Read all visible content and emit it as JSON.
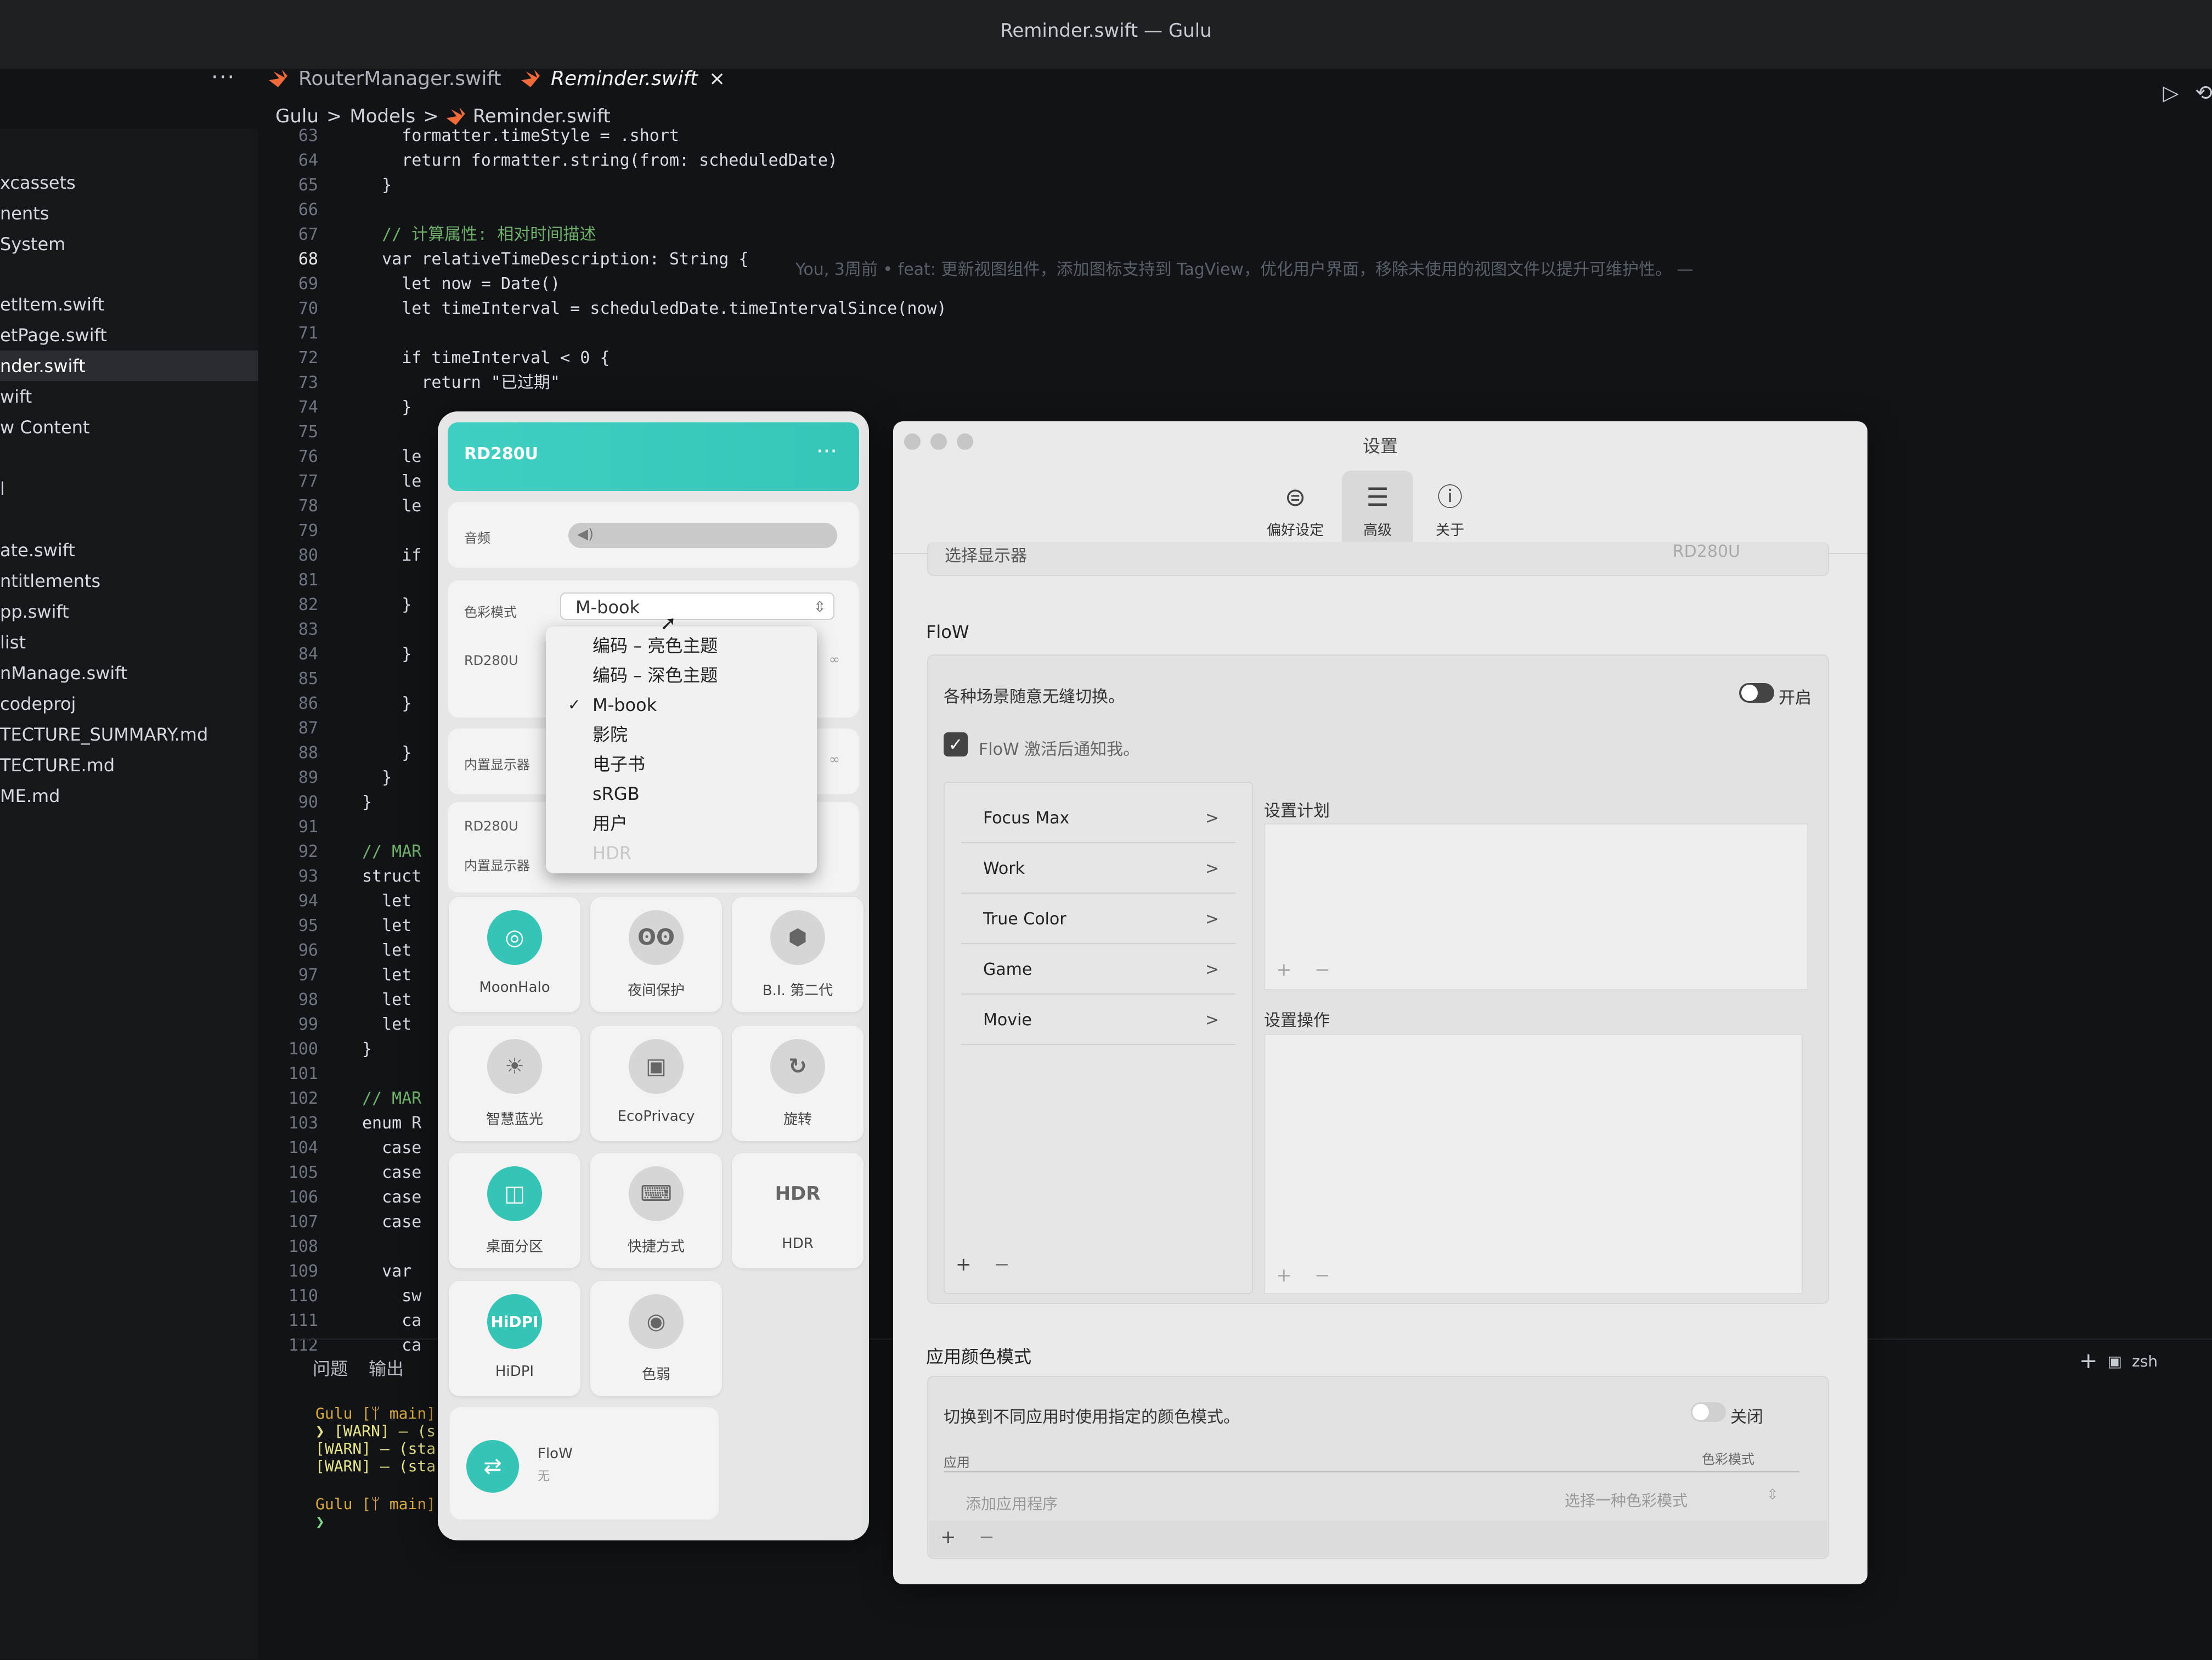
{
  "window_title": "Reminder.swift — Gulu",
  "tabs": [
    {
      "label": "RouterManager.swift"
    },
    {
      "label": "Reminder.swift"
    }
  ],
  "tab_close": "×",
  "more": "···",
  "breadcrumb": {
    "p1": "Gulu",
    "p2": "Models",
    "p3": "Reminder.swift",
    "sep": ">"
  },
  "sidebar_items": [
    "xcassets",
    "nents",
    "System",
    "etItem.swift",
    "etPage.swift",
    "nder.swift",
    "wift",
    "w Content",
    "l",
    "ate.swift",
    "ntitlements",
    "pp.swift",
    "list",
    "nManage.swift",
    "codeproj",
    "TECTURE_SUMMARY.md",
    "TECTURE.md",
    "ME.md"
  ],
  "code_lines": [
    {
      "n": "63",
      "t": "    formatter.timeStyle = .short"
    },
    {
      "n": "64",
      "t": "    return formatter.string(from: scheduledDate)"
    },
    {
      "n": "65",
      "t": "  }"
    },
    {
      "n": "66",
      "t": ""
    },
    {
      "n": "67",
      "t": "  // 计算属性: 相对时间描述"
    },
    {
      "n": "68",
      "t": "  var relativeTimeDescription: String {"
    },
    {
      "n": "69",
      "t": "    let now = Date()"
    },
    {
      "n": "70",
      "t": "    let timeInterval = scheduledDate.timeIntervalSince(now)"
    },
    {
      "n": "71",
      "t": ""
    },
    {
      "n": "72",
      "t": "    if timeInterval < 0 {"
    },
    {
      "n": "73",
      "t": "      return \"已过期\""
    },
    {
      "n": "74",
      "t": "    }"
    },
    {
      "n": "75",
      "t": ""
    },
    {
      "n": "76",
      "t": "    le"
    },
    {
      "n": "77",
      "t": "    le"
    },
    {
      "n": "78",
      "t": "    le"
    },
    {
      "n": "79",
      "t": ""
    },
    {
      "n": "80",
      "t": "    if"
    },
    {
      "n": "81",
      "t": ""
    },
    {
      "n": "82",
      "t": "    }"
    },
    {
      "n": "83",
      "t": ""
    },
    {
      "n": "84",
      "t": "    }"
    },
    {
      "n": "85",
      "t": ""
    },
    {
      "n": "86",
      "t": "    }"
    },
    {
      "n": "87",
      "t": ""
    },
    {
      "n": "88",
      "t": "    }"
    },
    {
      "n": "89",
      "t": "  }"
    },
    {
      "n": "90",
      "t": "}"
    },
    {
      "n": "91",
      "t": ""
    },
    {
      "n": "92",
      "t": "// MAR"
    },
    {
      "n": "93",
      "t": "struct"
    },
    {
      "n": "94",
      "t": "  let"
    },
    {
      "n": "95",
      "t": "  let"
    },
    {
      "n": "96",
      "t": "  let"
    },
    {
      "n": "97",
      "t": "  let"
    },
    {
      "n": "98",
      "t": "  let"
    },
    {
      "n": "99",
      "t": "  let"
    },
    {
      "n": "100",
      "t": "}"
    },
    {
      "n": "101",
      "t": ""
    },
    {
      "n": "102",
      "t": "// MAR"
    },
    {
      "n": "103",
      "t": "enum R"
    },
    {
      "n": "104",
      "t": "  case"
    },
    {
      "n": "105",
      "t": "  case"
    },
    {
      "n": "106",
      "t": "  case"
    },
    {
      "n": "107",
      "t": "  case"
    },
    {
      "n": "108",
      "t": ""
    },
    {
      "n": "109",
      "t": "  var"
    },
    {
      "n": "110",
      "t": "    sw"
    },
    {
      "n": "111",
      "t": "    ca"
    },
    {
      "n": "112",
      "t": "    ca"
    }
  ],
  "blame": "You, 3周前 • feat: 更新视图组件，添加图标支持到 TagView，优化用户界面，移除未使用的视图文件以提升可维护性。 —",
  "terminal": {
    "tabs": [
      "问题",
      "输出"
    ],
    "lines": [
      "Gulu [ᛘ main]",
      "❯ [WARN] – (s",
      "[WARN] – (sta",
      "[WARN] – (sta",
      "",
      "Gulu [ᛘ main]",
      "❯"
    ],
    "shell": "zsh",
    "plus": "+"
  },
  "widget": {
    "device": "RD280U",
    "menu_dots": "···",
    "volume_label": "音频",
    "color_mode_label": "色彩模式",
    "color_mode_value": "M-book",
    "display1": "RD280U",
    "display2": "内置显示器",
    "display3": "RD280U",
    "display4": "内置显示器",
    "tiles": [
      {
        "label": "MoonHalo",
        "icon": "monitor-halo-icon"
      },
      {
        "label": "夜间保护",
        "icon": "owl-icon"
      },
      {
        "label": "B.I. 第二代",
        "icon": "cube-icon"
      },
      {
        "label": "智慧蓝光",
        "icon": "bulb-icon"
      },
      {
        "label": "EcoPrivacy",
        "icon": "eco-monitor-icon"
      },
      {
        "label": "旋转",
        "icon": "rotate-icon"
      },
      {
        "label": "桌面分区",
        "icon": "split-screen-icon"
      },
      {
        "label": "快捷方式",
        "icon": "keyboard-icon"
      },
      {
        "label": "HDR",
        "icon": "hdr-icon"
      },
      {
        "label": "HiDPI",
        "icon": "hidpi-icon"
      },
      {
        "label": "色弱",
        "icon": "eye-icon"
      }
    ],
    "hdr_glyph": "HDR",
    "hidpi_glyph": "HiDPI",
    "flow": {
      "label": "FloW",
      "sub": "无"
    }
  },
  "dropdown": {
    "items": [
      "编码 – 亮色主题",
      "编码 – 深色主题",
      "M-book",
      "影院",
      "电子书",
      "sRGB",
      "用户",
      "HDR"
    ],
    "checked": "M-book",
    "check_mark": "✓"
  },
  "settings": {
    "title": "设置",
    "toolbar": [
      {
        "label": "偏好设定",
        "icon": "toggles-icon"
      },
      {
        "label": "高级",
        "icon": "sliders-icon"
      },
      {
        "label": "关于",
        "icon": "info-icon"
      }
    ],
    "partial_row": {
      "left": "选择显示器",
      "right": "RD280U"
    },
    "flow_title": "FloW",
    "flow_desc": "各种场景随意无缝切换。",
    "flow_toggle": "开启",
    "flow_notify": "FloW 激活后通知我。",
    "scenes": [
      "Focus Max",
      "Work",
      "True Color",
      "Game",
      "Movie"
    ],
    "chevron": ">",
    "plan_title": "设置计划",
    "action_title": "设置操作",
    "add": "+",
    "remove": "−",
    "app_color_title": "应用颜色模式",
    "app_color_desc": "切换到不同应用时使用指定的颜色模式。",
    "app_color_toggle": "关闭",
    "col_app": "应用",
    "col_mode": "色彩模式",
    "add_app_placeholder": "添加应用程序",
    "choose_mode_placeholder": "选择一种色彩模式",
    "accent": "#36c4b6"
  }
}
